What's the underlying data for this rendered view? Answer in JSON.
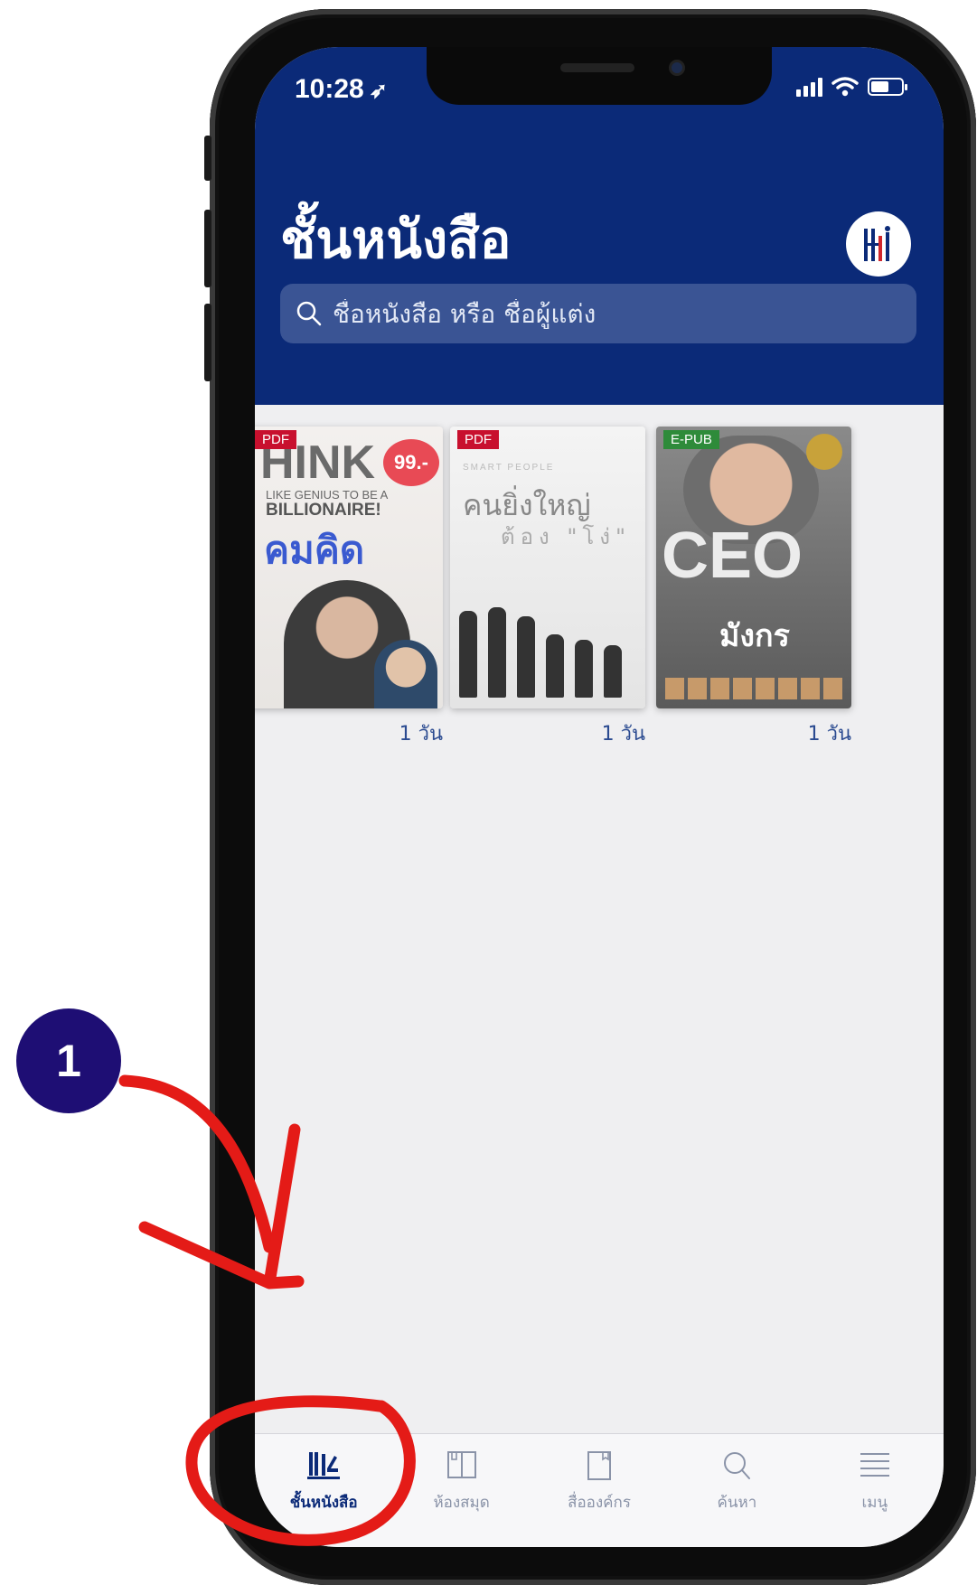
{
  "status_bar": {
    "time": "10:28"
  },
  "header": {
    "title": "ชั้นหนังสือ",
    "search_placeholder": "ชื่อหนังสือ หรือ ชื่อผู้แต่ง"
  },
  "books": [
    {
      "format": "PDF",
      "days_left": "1 วัน"
    },
    {
      "format": "PDF",
      "days_left": "1 วัน"
    },
    {
      "format": "E-PUB",
      "days_left": "1 วัน"
    }
  ],
  "tab_bar": {
    "items": [
      {
        "label": "ชั้นหนังสือ",
        "icon": "bookshelf-icon",
        "active": true
      },
      {
        "label": "ห้องสมุด",
        "icon": "library-icon",
        "active": false
      },
      {
        "label": "สื่อองค์กร",
        "icon": "org-media-icon",
        "active": false
      },
      {
        "label": "ค้นหา",
        "icon": "search-icon",
        "active": false
      },
      {
        "label": "เมนู",
        "icon": "menu-icon",
        "active": false
      }
    ]
  },
  "annotation": {
    "step_number": "1"
  },
  "colors": {
    "header_bg": "#0b2a78",
    "accent": "#0b2a78",
    "badge_pdf": "#c8102e",
    "badge_epub": "#2e8b3a",
    "annotation_red": "#e41b17",
    "step_badge": "#1e0e74"
  }
}
